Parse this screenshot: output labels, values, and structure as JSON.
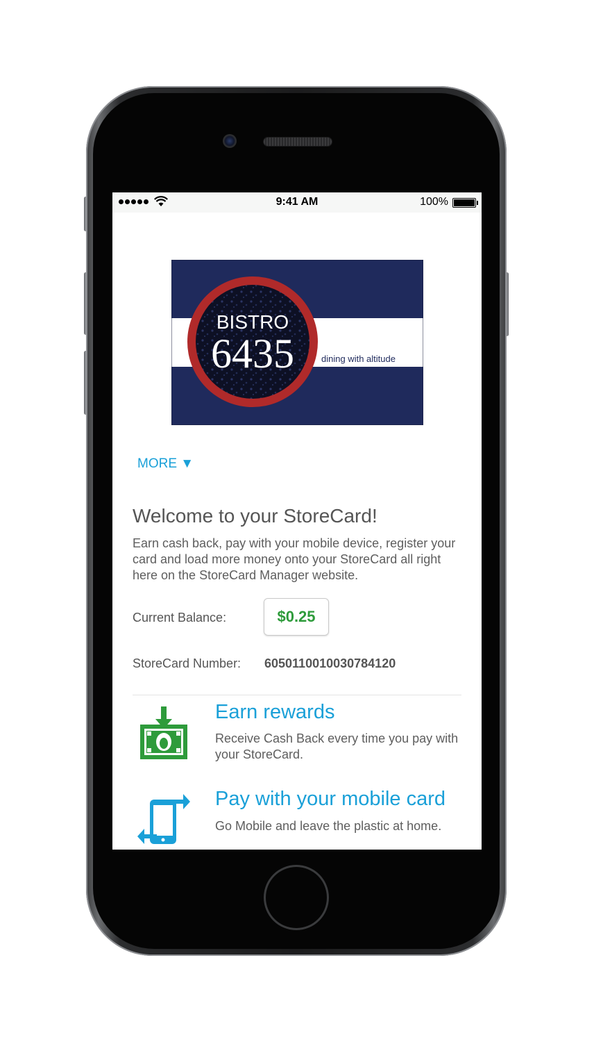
{
  "status_bar": {
    "time": "9:41 AM",
    "battery": "100%",
    "signal_icon": "signal-dots-icon",
    "wifi_icon": "wifi-icon",
    "battery_icon": "battery-icon"
  },
  "card": {
    "brand_line1": "BISTRO",
    "brand_line2": "6435",
    "tagline": "dining with altitude",
    "colors": {
      "navy": "#1f2a5c",
      "red": "#b02a2a"
    }
  },
  "more_link": "MORE ▼",
  "welcome": {
    "heading": "Welcome to your StoreCard!",
    "text": "Earn cash back, pay with your mobile device, register your card and load more money onto your StoreCard all right here on the StoreCard Manager website."
  },
  "balance": {
    "label": "Current Balance:",
    "value": "$0.25"
  },
  "storecard": {
    "label": "StoreCard Number:",
    "value": "6050110010030784120"
  },
  "features": [
    {
      "icon": "cash-rewards-icon",
      "title": "Earn rewards",
      "text": "Receive Cash Back every time you pay with your StoreCard."
    },
    {
      "icon": "mobile-pay-icon",
      "title": "Pay with your mobile card",
      "text": "Go Mobile and leave the plastic at home."
    }
  ],
  "colors": {
    "accent_blue": "#1aa0d8",
    "balance_green": "#2e9b3b",
    "icon_green": "#2e9b3b"
  }
}
